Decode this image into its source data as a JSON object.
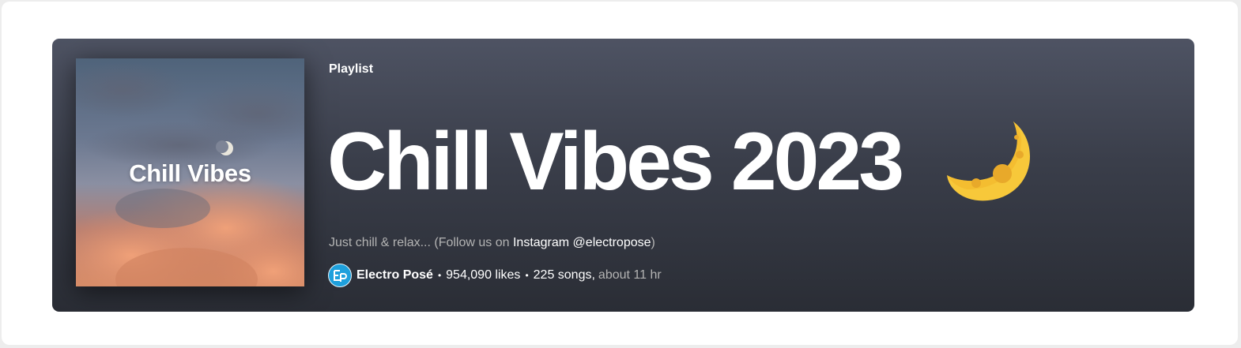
{
  "playlist": {
    "type_label": "Playlist",
    "title": "Chill Vibes 2023",
    "title_emoji": "crescent-moon-icon",
    "cover_text": "Chill Vibes",
    "description_prefix": "Just chill & relax... (Follow us on ",
    "description_link": "Instagram @electropose",
    "description_suffix": ")",
    "owner": "Electro Posé",
    "likes": "954,090 likes",
    "songs": "225 songs,",
    "duration": "about 11 hr",
    "separator": "•"
  },
  "colors": {
    "banner_top": "#4e5363",
    "banner_bottom": "#2a2d35",
    "moon_yellow": "#f7c83a",
    "avatar_blue": "#1ea0dc"
  }
}
